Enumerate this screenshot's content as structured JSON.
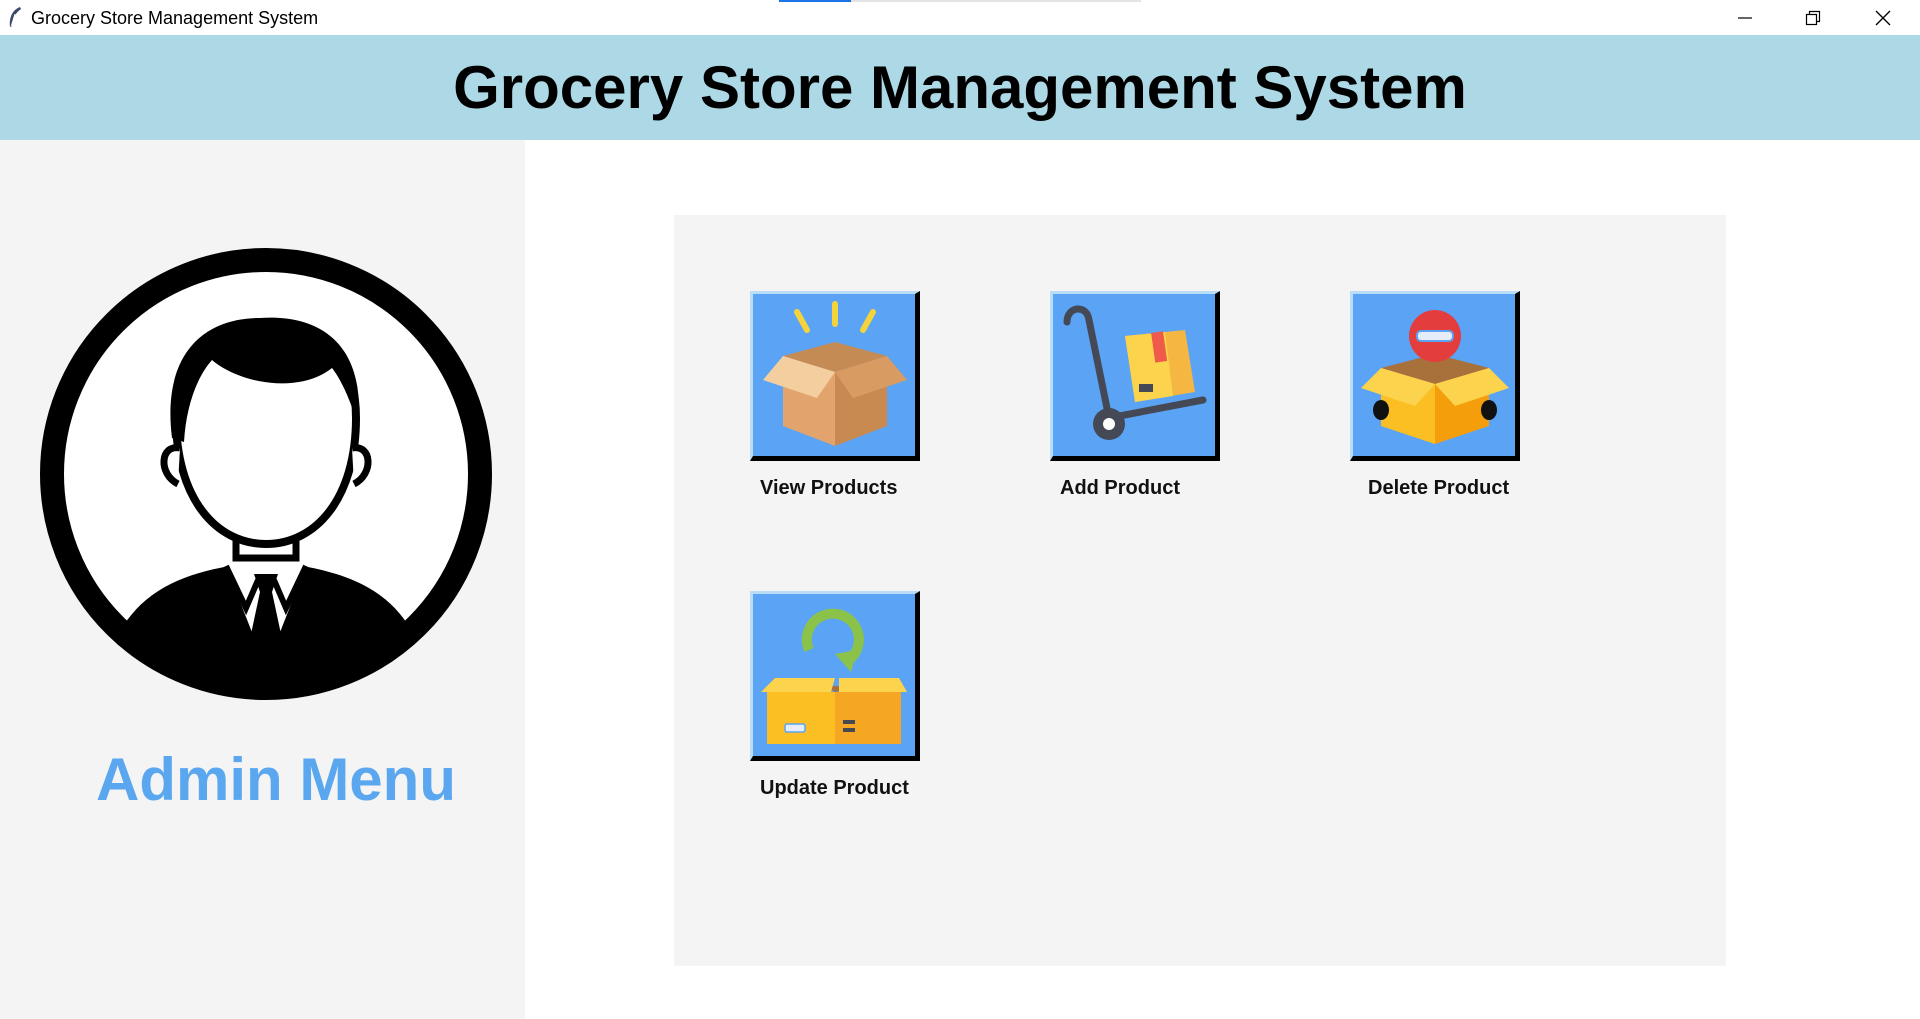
{
  "window": {
    "title": "Grocery Store Management System",
    "controls": {
      "minimize": "minimize-icon",
      "maximize": "restore-icon",
      "close": "close-icon"
    },
    "app_icon": "feather-icon"
  },
  "header": {
    "title": "Grocery Store Management System",
    "background": "#add8e6"
  },
  "sidebar": {
    "avatar_icon": "admin-avatar-icon",
    "label": "Admin Menu",
    "label_color": "#5aa7ef",
    "background": "#f4f4f4"
  },
  "menu": {
    "tile_color": "#5aa3f5",
    "items": [
      {
        "label": "View Products",
        "icon": "open-box-icon"
      },
      {
        "label": "Add Product",
        "icon": "hand-truck-icon"
      },
      {
        "label": "Delete Product",
        "icon": "box-remove-icon"
      },
      {
        "label": "Update Product",
        "icon": "box-refresh-icon"
      }
    ]
  }
}
